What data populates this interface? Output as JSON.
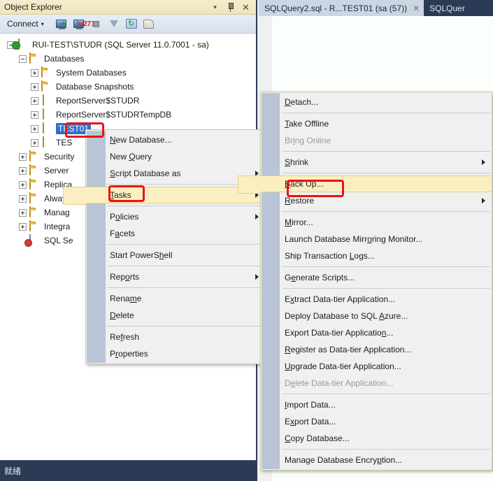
{
  "object_explorer": {
    "title": "Object Explorer",
    "titlebar_buttons": [
      {
        "name": "chevron-down-icon",
        "glyph": "▾"
      },
      {
        "name": "pin-icon",
        "glyph": ""
      },
      {
        "name": "close-icon",
        "glyph": "✕"
      }
    ],
    "toolbar": {
      "connect_label": "Connect",
      "connect_caret": "▾",
      "icons": [
        "connect-server-icon",
        "disconnect-server-icon",
        "stop-icon",
        "filter-icon",
        "refresh-icon",
        "script-icon"
      ],
      "refresh_glyph": "↻"
    },
    "tree": [
      {
        "label": "RUI-TEST\\STUDR (SQL Server 11.0.7001 - sa)",
        "indent": 0,
        "expander": "minus",
        "icon": "server-icon"
      },
      {
        "label": "Databases",
        "indent": 1,
        "expander": "minus",
        "icon": "folder-icon"
      },
      {
        "label": "System Databases",
        "indent": 2,
        "expander": "plus",
        "icon": "folder-icon"
      },
      {
        "label": "Database Snapshots",
        "indent": 2,
        "expander": "plus",
        "icon": "folder-icon"
      },
      {
        "label": "ReportServer$STUDR",
        "indent": 2,
        "expander": "plus",
        "icon": "database-icon"
      },
      {
        "label": "ReportServer$STUDRTempDB",
        "indent": 2,
        "expander": "plus",
        "icon": "database-icon"
      },
      {
        "label": "TEST01",
        "indent": 2,
        "expander": "plus",
        "icon": "database-icon",
        "selected": true
      },
      {
        "label": "TES",
        "indent": 2,
        "expander": "plus",
        "icon": "database-icon"
      },
      {
        "label": "Security",
        "indent": 1,
        "expander": "plus",
        "icon": "folder-icon"
      },
      {
        "label": "Server",
        "indent": 1,
        "expander": "plus",
        "icon": "folder-icon"
      },
      {
        "label": "Replica",
        "indent": 1,
        "expander": "plus",
        "icon": "folder-icon"
      },
      {
        "label": "Always",
        "indent": 1,
        "expander": "plus",
        "icon": "folder-icon"
      },
      {
        "label": "Manag",
        "indent": 1,
        "expander": "plus",
        "icon": "folder-icon"
      },
      {
        "label": "Integra",
        "indent": 1,
        "expander": "plus",
        "icon": "folder-icon"
      },
      {
        "label": "SQL Se",
        "indent": 1,
        "expander": "none",
        "icon": "sql-server-agent-icon"
      }
    ]
  },
  "statusbar": {
    "text": "就绪"
  },
  "editor": {
    "tabs": [
      {
        "label": "SQLQuery2.sql - R...TEST01 (sa (57))",
        "active": true,
        "close_glyph": "✕"
      },
      {
        "label": "SQLQuer",
        "active": false
      }
    ]
  },
  "context_menu_database": {
    "items": [
      {
        "type": "item",
        "label": "New Database...",
        "accel": "N"
      },
      {
        "type": "item",
        "label": "New Query",
        "accel": "Q"
      },
      {
        "type": "item",
        "label": "Script Database as",
        "accel": "S",
        "submenu": true
      },
      {
        "type": "separator"
      },
      {
        "type": "item",
        "label": "Tasks",
        "accel": "T",
        "submenu": true,
        "highlighted": true
      },
      {
        "type": "separator"
      },
      {
        "type": "item",
        "label": "Policies",
        "accel": "o",
        "submenu": true
      },
      {
        "type": "item",
        "label": "Facets",
        "accel": "a"
      },
      {
        "type": "separator"
      },
      {
        "type": "item",
        "label": "Start PowerShell",
        "accel": "h"
      },
      {
        "type": "separator"
      },
      {
        "type": "item",
        "label": "Reports",
        "accel": "o",
        "submenu": true
      },
      {
        "type": "separator"
      },
      {
        "type": "item",
        "label": "Rename",
        "accel": "m"
      },
      {
        "type": "item",
        "label": "Delete",
        "accel": "D"
      },
      {
        "type": "separator"
      },
      {
        "type": "item",
        "label": "Refresh",
        "accel": "f"
      },
      {
        "type": "item",
        "label": "Properties",
        "accel": "r"
      }
    ]
  },
  "context_menu_tasks": {
    "items": [
      {
        "type": "item",
        "label": "Detach...",
        "accel": "D"
      },
      {
        "type": "separator"
      },
      {
        "type": "item",
        "label": "Take Offline",
        "accel": "T"
      },
      {
        "type": "item",
        "label": "Bring Online",
        "accel": "i",
        "disabled": true
      },
      {
        "type": "separator"
      },
      {
        "type": "item",
        "label": "Shrink",
        "accel": "S",
        "submenu": true
      },
      {
        "type": "separator"
      },
      {
        "type": "item",
        "label": "Back Up...",
        "accel": "B",
        "highlighted": true
      },
      {
        "type": "item",
        "label": "Restore",
        "accel": "R",
        "submenu": true
      },
      {
        "type": "separator"
      },
      {
        "type": "item",
        "label": "Mirror...",
        "accel": "M"
      },
      {
        "type": "item",
        "label": "Launch Database Mirroring Monitor...",
        "accel": "o"
      },
      {
        "type": "item",
        "label": "Ship Transaction Logs...",
        "accel": "L"
      },
      {
        "type": "separator"
      },
      {
        "type": "item",
        "label": "Generate Scripts...",
        "accel": "e"
      },
      {
        "type": "separator"
      },
      {
        "type": "item",
        "label": "Extract Data-tier Application...",
        "accel": "x"
      },
      {
        "type": "item",
        "label": "Deploy Database to SQL Azure...",
        "accel": "A"
      },
      {
        "type": "item",
        "label": "Export Data-tier Application...",
        "accel": "n"
      },
      {
        "type": "item",
        "label": "Register as Data-tier Application...",
        "accel": "R"
      },
      {
        "type": "item",
        "label": "Upgrade Data-tier Application...",
        "accel": "U"
      },
      {
        "type": "item",
        "label": "Delete Data-tier Application...",
        "accel": "e",
        "disabled": true
      },
      {
        "type": "separator"
      },
      {
        "type": "item",
        "label": "Import Data...",
        "accel": "I"
      },
      {
        "type": "item",
        "label": "Export Data...",
        "accel": "x"
      },
      {
        "type": "item",
        "label": "Copy Database...",
        "accel": "C"
      },
      {
        "type": "separator"
      },
      {
        "type": "item",
        "label": "Manage Database Encryption...",
        "accel": "p"
      }
    ]
  },
  "annotations": {
    "color": "#ee1111",
    "boxes": [
      {
        "name": "annotation-database-node"
      },
      {
        "name": "annotation-tasks-item"
      },
      {
        "name": "annotation-backup-item"
      }
    ]
  }
}
